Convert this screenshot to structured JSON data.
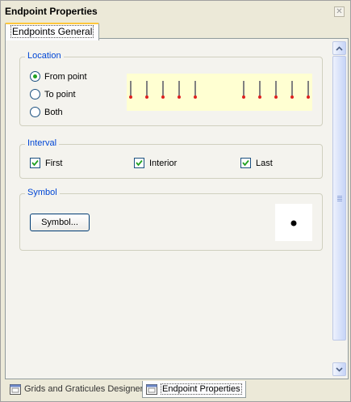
{
  "window": {
    "title": "Endpoint Properties",
    "close_glyph": "✕"
  },
  "tabs": [
    {
      "label": "Endpoints General",
      "active": true
    }
  ],
  "location": {
    "label": "Location",
    "options": [
      {
        "label": "From point",
        "selected": true
      },
      {
        "label": "To point",
        "selected": false
      },
      {
        "label": "Both",
        "selected": false
      }
    ],
    "preview_bg": "#ffffd2",
    "marker_color": "#e02020"
  },
  "interval": {
    "label": "Interval",
    "options": [
      {
        "label": "First",
        "checked": true
      },
      {
        "label": "Interior",
        "checked": true
      },
      {
        "label": "Last",
        "checked": true
      }
    ]
  },
  "symbol": {
    "label": "Symbol",
    "button_label": "Symbol..."
  },
  "bottom_tabs": [
    {
      "label": "Grids and Graticules Designer",
      "active": false,
      "icon": "window-icon"
    },
    {
      "label": "Endpoint Properties",
      "active": true,
      "icon": "window-icon"
    }
  ]
}
